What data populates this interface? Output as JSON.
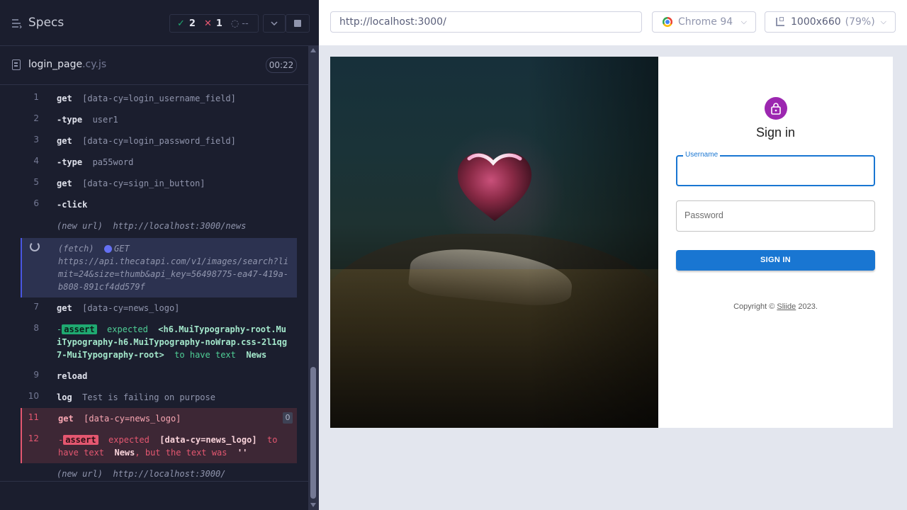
{
  "runner": {
    "title": "Specs",
    "stats": {
      "passed": "2",
      "failed": "1",
      "pending": "--"
    },
    "spec": {
      "name": "login_page",
      "ext": ".cy.js",
      "duration": "00:22"
    },
    "commands": [
      {
        "num": "1",
        "name": "get",
        "selector": "[data-cy=login_username_field]"
      },
      {
        "num": "2",
        "name": "-type",
        "message": "user1"
      },
      {
        "num": "3",
        "name": "get",
        "selector": "[data-cy=login_password_field]"
      },
      {
        "num": "4",
        "name": "-type",
        "message": "pa55word"
      },
      {
        "num": "5",
        "name": "get",
        "selector": "[data-cy=sign_in_button]"
      },
      {
        "num": "6",
        "name": "-click"
      },
      {
        "new_url_label": "(new url)",
        "new_url": "http://localhost:3000/news"
      },
      {
        "fetch_label": "(fetch)",
        "method": "GET",
        "url": "https://api.thecatapi.com/v1/images/search?limit=24&size=thumb&api_key=56498775-ea47-419a-b808-891cf4dd579f"
      },
      {
        "num": "7",
        "name": "get",
        "selector": "[data-cy=news_logo]"
      },
      {
        "num": "8",
        "dash": "-",
        "badge": "assert",
        "expected": "expected",
        "element": "<h6.MuiTypography-root.MuiTypography-h6.MuiTypography-noWrap.css-2l1qg7-MuiTypography-root>",
        "to_have": "to have text",
        "text": "News"
      },
      {
        "num": "9",
        "name": "reload"
      },
      {
        "num": "10",
        "name": "log",
        "message": "Test is failing on purpose"
      },
      {
        "num": "11",
        "name": "get",
        "selector": "[data-cy=news_logo]",
        "count": "0"
      },
      {
        "num": "12",
        "dash": "-",
        "badge": "assert",
        "expected": "expected",
        "selector": "[data-cy=news_logo]",
        "to_have": "to have text",
        "text": "News",
        "but": ", but the text was",
        "actual": "''"
      },
      {
        "new_url_label": "(new url)",
        "new_url": "http://localhost:3000/"
      }
    ]
  },
  "aut": {
    "url": "http://localhost:3000/",
    "browser": "Chrome 94",
    "viewport": "1000x660",
    "scale": "(79%)"
  },
  "login": {
    "title": "Sign in",
    "username_label": "Username",
    "password_placeholder": "Password",
    "button": "SIGN IN",
    "copyright_prefix": "Copyright © ",
    "copyright_link": "Sliide",
    "copyright_suffix": " 2023."
  },
  "colors": {
    "pass": "#1fa971",
    "fail": "#e45770",
    "primary": "#1976d2",
    "avatar": "#9c27b0"
  }
}
